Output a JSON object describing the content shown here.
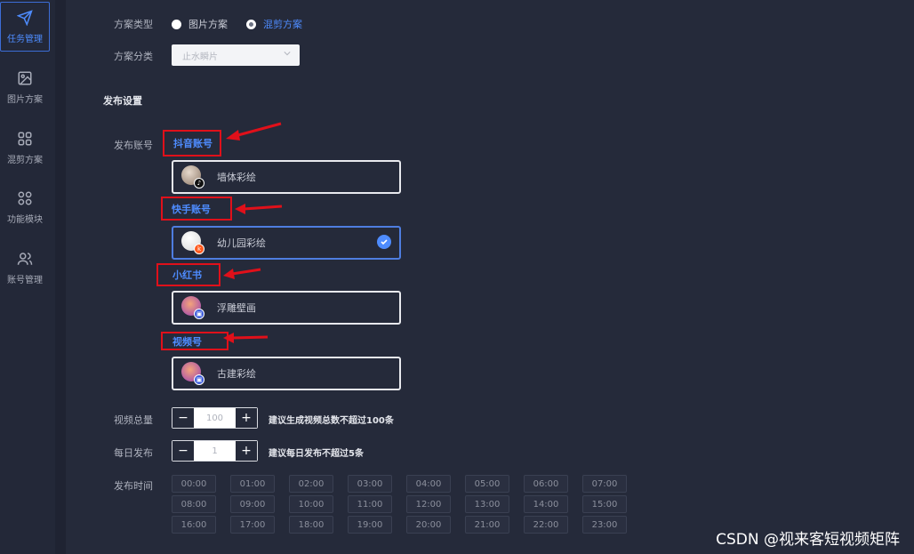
{
  "sidebar": {
    "items": [
      {
        "label": "任务管理",
        "icon": "send-icon",
        "active": true
      },
      {
        "label": "图片方案",
        "icon": "image-icon",
        "active": false
      },
      {
        "label": "混剪方案",
        "icon": "grid-icon",
        "active": false
      },
      {
        "label": "功能模块",
        "icon": "modules-icon",
        "active": false
      },
      {
        "label": "账号管理",
        "icon": "users-icon",
        "active": false
      }
    ]
  },
  "form": {
    "plan_type_label": "方案类型",
    "plan_type_options": [
      "图片方案",
      "混剪方案"
    ],
    "plan_type_selected": "混剪方案",
    "plan_category_label": "方案分类",
    "plan_category_placeholder": "止水瞬片",
    "publish_section_title": "发布设置",
    "publish_account_label": "发布账号",
    "platforms": [
      {
        "tag": "抖音账号",
        "account": "墙体彩绘",
        "badge_icon": "douyin-icon",
        "selected": false
      },
      {
        "tag": "快手账号",
        "account": "幼儿园彩绘",
        "badge_icon": "kuaishou-icon",
        "selected": true
      },
      {
        "tag": "小红书",
        "account": "浮雕壁画",
        "badge_icon": "xiaohongshu-icon",
        "selected": false
      },
      {
        "tag": "视频号",
        "account": "古建彩绘",
        "badge_icon": "channels-icon",
        "selected": false
      }
    ],
    "video_total_label": "视频总量",
    "video_total_value": "100",
    "video_total_hint": "建议生成视频总数不超过100条",
    "daily_publish_label": "每日发布",
    "daily_publish_value": "1",
    "daily_publish_hint": "建议每日发布不超过5条",
    "publish_time_label": "发布时间",
    "times": [
      "00:00",
      "01:00",
      "02:00",
      "03:00",
      "04:00",
      "05:00",
      "06:00",
      "07:00",
      "08:00",
      "09:00",
      "10:00",
      "11:00",
      "12:00",
      "13:00",
      "14:00",
      "15:00",
      "16:00",
      "17:00",
      "18:00",
      "19:00",
      "20:00",
      "21:00",
      "22:00",
      "23:00"
    ]
  },
  "watermark": "CSDN @视来客短视频矩阵",
  "colors": {
    "accent": "#4e8cff",
    "annotation": "#e0101a",
    "background": "#252a3a"
  }
}
